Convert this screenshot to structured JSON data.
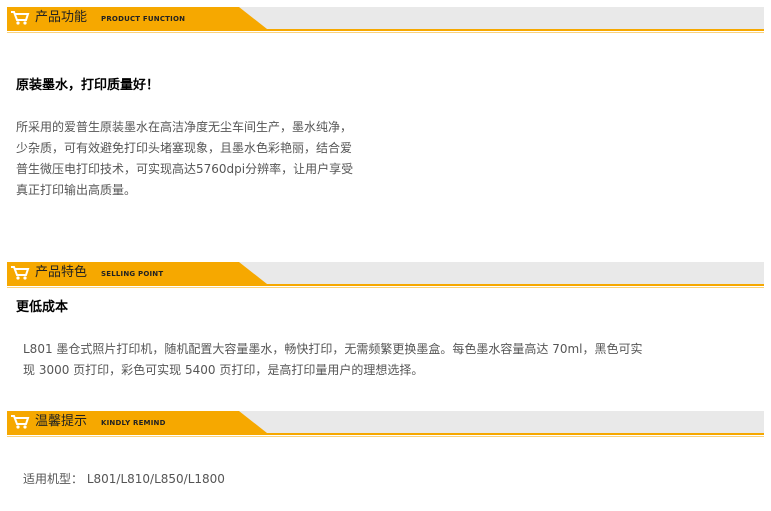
{
  "colors": {
    "accent": "#f6a800",
    "band": "#e9e9e9",
    "text": "#555555"
  },
  "sections": [
    {
      "title_cn": "产品功能",
      "title_en": "PRODUCT FUNCTION",
      "heading": "原装墨水，打印质量好！",
      "body_lines": [
        "所采用的爱普生原装墨水在高洁净度无尘车间生产，墨水纯净，",
        "少杂质，可有效避免打印头堵塞现象，且墨水色彩艳丽，结合爱",
        "普生微压电打印技术，可实现高达5760dpi分辨率，让用户享受",
        "真正打印输出高质量。"
      ]
    },
    {
      "title_cn": "产品特色",
      "title_en": "SELLING POINT",
      "heading": "更低成本",
      "body_lines": [
        "L801 墨仓式照片打印机，随机配置大容量墨水，畅快打印，无需频繁更换墨盒。每色墨水容量高达 70ml，黑色可实",
        "现 3000 页打印，彩色可实现 5400 页打印，是高打印量用户的理想选择。"
      ]
    },
    {
      "title_cn": "温馨提示",
      "title_en": "KINDLY REMIND",
      "body_lines": [
        "适用机型： L801/L810/L850/L1800"
      ]
    }
  ]
}
